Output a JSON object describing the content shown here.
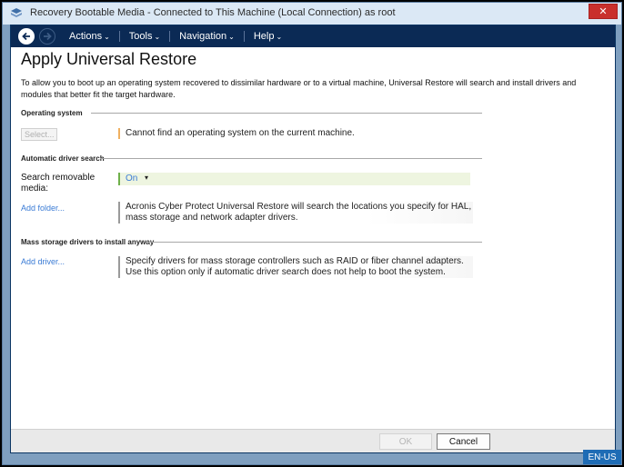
{
  "window": {
    "title": "Recovery Bootable Media - Connected to This Machine (Local Connection) as root",
    "close_label": "✕"
  },
  "nav": {
    "menus": [
      "Actions",
      "Tools",
      "Navigation",
      "Help"
    ]
  },
  "page": {
    "title": "Apply Universal Restore",
    "intro": "To allow you to boot up an operating system recovered to dissimilar hardware or to a virtual machine, Universal Restore will search and install drivers and modules that better fit the target hardware."
  },
  "sections": {
    "os": {
      "header": "Operating system",
      "select_label": "Select...",
      "note": "Cannot find an operating system on the current machine."
    },
    "auto": {
      "header": "Automatic driver search",
      "search_label": "Search removable media:",
      "search_value": "On",
      "add_folder": "Add folder...",
      "note": "Acronis Cyber Protect Universal Restore will search the locations you specify for HAL, mass storage and network adapter drivers."
    },
    "mass": {
      "header": "Mass storage drivers to install anyway",
      "add_driver": "Add driver...",
      "note": "Specify drivers for mass storage controllers such as RAID or fiber channel adapters. Use this option only if automatic driver search does not help to boot the system."
    }
  },
  "footer": {
    "ok_label": "OK",
    "cancel_label": "Cancel"
  },
  "status": {
    "locale": "EN-US"
  },
  "colors": {
    "navbar": "#0b2a55",
    "link": "#3a7bd5",
    "accent_green": "#6fb04a",
    "accent_orange": "#f0b060",
    "close": "#c9302c",
    "locale_badge": "#1e6cb5"
  }
}
